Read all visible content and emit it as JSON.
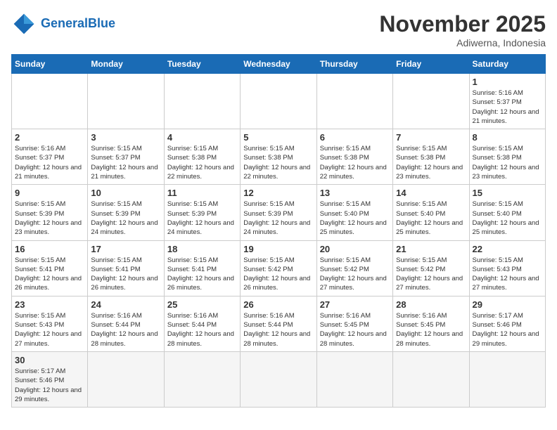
{
  "header": {
    "logo_general": "General",
    "logo_blue": "Blue",
    "month_year": "November 2025",
    "location": "Adiwerna, Indonesia"
  },
  "days_of_week": [
    "Sunday",
    "Monday",
    "Tuesday",
    "Wednesday",
    "Thursday",
    "Friday",
    "Saturday"
  ],
  "weeks": [
    [
      {
        "day": "",
        "info": ""
      },
      {
        "day": "",
        "info": ""
      },
      {
        "day": "",
        "info": ""
      },
      {
        "day": "",
        "info": ""
      },
      {
        "day": "",
        "info": ""
      },
      {
        "day": "",
        "info": ""
      },
      {
        "day": "1",
        "info": "Sunrise: 5:16 AM\nSunset: 5:37 PM\nDaylight: 12 hours\nand 21 minutes."
      }
    ],
    [
      {
        "day": "2",
        "info": "Sunrise: 5:16 AM\nSunset: 5:37 PM\nDaylight: 12 hours\nand 21 minutes."
      },
      {
        "day": "3",
        "info": "Sunrise: 5:15 AM\nSunset: 5:37 PM\nDaylight: 12 hours\nand 21 minutes."
      },
      {
        "day": "4",
        "info": "Sunrise: 5:15 AM\nSunset: 5:38 PM\nDaylight: 12 hours\nand 22 minutes."
      },
      {
        "day": "5",
        "info": "Sunrise: 5:15 AM\nSunset: 5:38 PM\nDaylight: 12 hours\nand 22 minutes."
      },
      {
        "day": "6",
        "info": "Sunrise: 5:15 AM\nSunset: 5:38 PM\nDaylight: 12 hours\nand 22 minutes."
      },
      {
        "day": "7",
        "info": "Sunrise: 5:15 AM\nSunset: 5:38 PM\nDaylight: 12 hours\nand 23 minutes."
      },
      {
        "day": "8",
        "info": "Sunrise: 5:15 AM\nSunset: 5:38 PM\nDaylight: 12 hours\nand 23 minutes."
      }
    ],
    [
      {
        "day": "9",
        "info": "Sunrise: 5:15 AM\nSunset: 5:39 PM\nDaylight: 12 hours\nand 23 minutes."
      },
      {
        "day": "10",
        "info": "Sunrise: 5:15 AM\nSunset: 5:39 PM\nDaylight: 12 hours\nand 24 minutes."
      },
      {
        "day": "11",
        "info": "Sunrise: 5:15 AM\nSunset: 5:39 PM\nDaylight: 12 hours\nand 24 minutes."
      },
      {
        "day": "12",
        "info": "Sunrise: 5:15 AM\nSunset: 5:39 PM\nDaylight: 12 hours\nand 24 minutes."
      },
      {
        "day": "13",
        "info": "Sunrise: 5:15 AM\nSunset: 5:40 PM\nDaylight: 12 hours\nand 25 minutes."
      },
      {
        "day": "14",
        "info": "Sunrise: 5:15 AM\nSunset: 5:40 PM\nDaylight: 12 hours\nand 25 minutes."
      },
      {
        "day": "15",
        "info": "Sunrise: 5:15 AM\nSunset: 5:40 PM\nDaylight: 12 hours\nand 25 minutes."
      }
    ],
    [
      {
        "day": "16",
        "info": "Sunrise: 5:15 AM\nSunset: 5:41 PM\nDaylight: 12 hours\nand 26 minutes."
      },
      {
        "day": "17",
        "info": "Sunrise: 5:15 AM\nSunset: 5:41 PM\nDaylight: 12 hours\nand 26 minutes."
      },
      {
        "day": "18",
        "info": "Sunrise: 5:15 AM\nSunset: 5:41 PM\nDaylight: 12 hours\nand 26 minutes."
      },
      {
        "day": "19",
        "info": "Sunrise: 5:15 AM\nSunset: 5:42 PM\nDaylight: 12 hours\nand 26 minutes."
      },
      {
        "day": "20",
        "info": "Sunrise: 5:15 AM\nSunset: 5:42 PM\nDaylight: 12 hours\nand 27 minutes."
      },
      {
        "day": "21",
        "info": "Sunrise: 5:15 AM\nSunset: 5:42 PM\nDaylight: 12 hours\nand 27 minutes."
      },
      {
        "day": "22",
        "info": "Sunrise: 5:15 AM\nSunset: 5:43 PM\nDaylight: 12 hours\nand 27 minutes."
      }
    ],
    [
      {
        "day": "23",
        "info": "Sunrise: 5:15 AM\nSunset: 5:43 PM\nDaylight: 12 hours\nand 27 minutes."
      },
      {
        "day": "24",
        "info": "Sunrise: 5:16 AM\nSunset: 5:44 PM\nDaylight: 12 hours\nand 28 minutes."
      },
      {
        "day": "25",
        "info": "Sunrise: 5:16 AM\nSunset: 5:44 PM\nDaylight: 12 hours\nand 28 minutes."
      },
      {
        "day": "26",
        "info": "Sunrise: 5:16 AM\nSunset: 5:44 PM\nDaylight: 12 hours\nand 28 minutes."
      },
      {
        "day": "27",
        "info": "Sunrise: 5:16 AM\nSunset: 5:45 PM\nDaylight: 12 hours\nand 28 minutes."
      },
      {
        "day": "28",
        "info": "Sunrise: 5:16 AM\nSunset: 5:45 PM\nDaylight: 12 hours\nand 28 minutes."
      },
      {
        "day": "29",
        "info": "Sunrise: 5:17 AM\nSunset: 5:46 PM\nDaylight: 12 hours\nand 29 minutes."
      }
    ],
    [
      {
        "day": "30",
        "info": "Sunrise: 5:17 AM\nSunset: 5:46 PM\nDaylight: 12 hours\nand 29 minutes."
      },
      {
        "day": "",
        "info": ""
      },
      {
        "day": "",
        "info": ""
      },
      {
        "day": "",
        "info": ""
      },
      {
        "day": "",
        "info": ""
      },
      {
        "day": "",
        "info": ""
      },
      {
        "day": "",
        "info": ""
      }
    ]
  ]
}
